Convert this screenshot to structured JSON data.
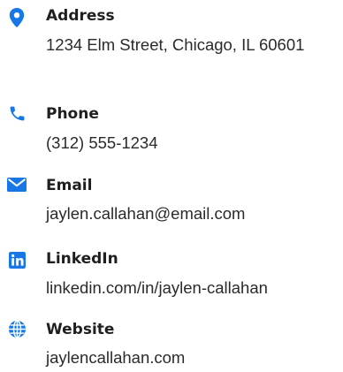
{
  "accent_color": "#1877e6",
  "contact": {
    "address": {
      "icon": "map-pin-icon",
      "label": "Address",
      "value": "1234 Elm Street, Chicago, IL 60601"
    },
    "phone": {
      "icon": "phone-icon",
      "label": "Phone",
      "value": "(312) 555-1234"
    },
    "email": {
      "icon": "envelope-icon",
      "label": "Email",
      "value": "jaylen.callahan@email.com"
    },
    "linkedin": {
      "icon": "linkedin-icon",
      "label": "LinkedIn",
      "value": "linkedin.com/in/jaylen-callahan"
    },
    "website": {
      "icon": "globe-icon",
      "label": "Website",
      "value": "jaylencallahan.com"
    }
  }
}
